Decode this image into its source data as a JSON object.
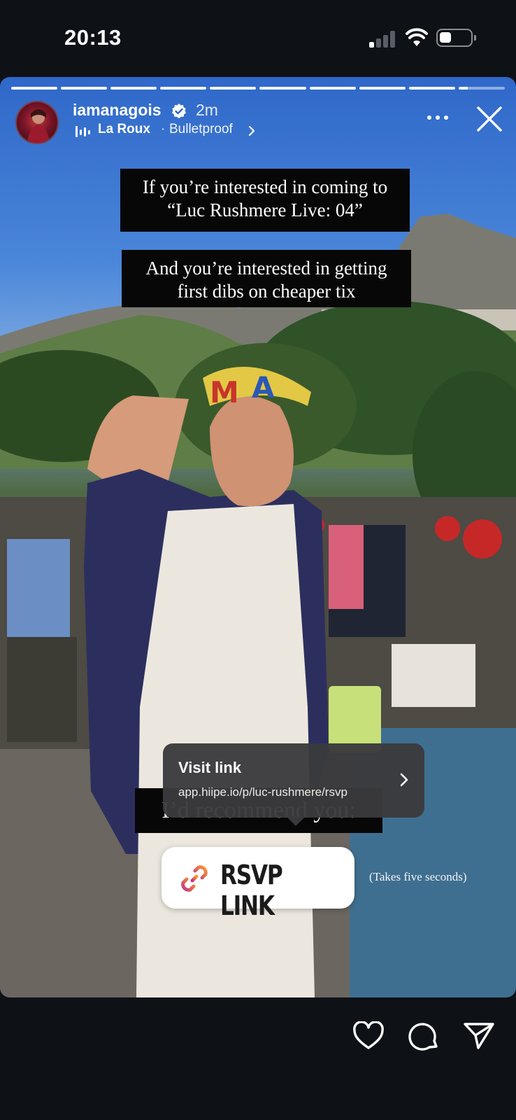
{
  "status_bar": {
    "time": "20:13"
  },
  "story": {
    "progress_segments": 10,
    "account": {
      "username": "iamanagois",
      "verified": true,
      "posted": "2m"
    },
    "music": {
      "artist": "La Roux",
      "separator": "·",
      "song": "Bulletproof"
    },
    "captions": [
      "If you’re interested in coming to “Luc Rushmere Live: 04”",
      "And you’re interested in getting first dibs on cheaper tix",
      "I’d recommend you:"
    ],
    "link_tooltip": {
      "title": "Visit link",
      "url": "app.hiipe.io/p/luc-rushmere/rsvp"
    },
    "link_sticker": {
      "label": "RSVP LINK",
      "icon": "link-icon"
    },
    "note": "(Takes five seconds)"
  },
  "bottom_bar": {
    "icons": [
      "heart-icon",
      "comment-icon",
      "send-icon"
    ]
  },
  "colors": {
    "background": "#0e1116",
    "caption_bg": "#070707",
    "tooltip_bg": "#3a3a3c",
    "sticker_bg": "#ffffff",
    "link_gradient_start": "#ff9a2e",
    "link_gradient_end": "#c13584"
  }
}
